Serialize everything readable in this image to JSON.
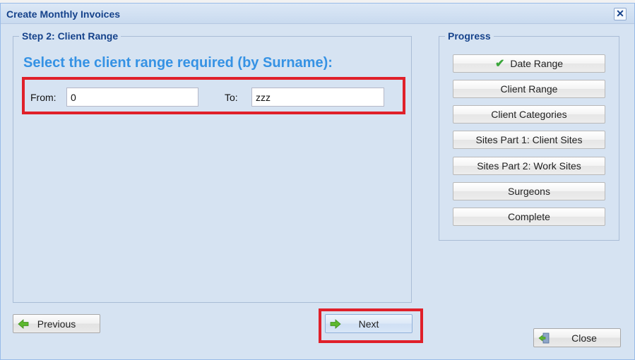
{
  "window": {
    "title": "Create Monthly Invoices",
    "close_glyph": "✕"
  },
  "step": {
    "legend": "Step 2: Client Range",
    "heading": "Select the client range required (by Surname):",
    "from_label": "From:",
    "from_value": "0",
    "to_label": "To:",
    "to_value": "zzz"
  },
  "progress": {
    "legend": "Progress",
    "items": [
      {
        "label": "Date Range",
        "completed": true,
        "icon": "checkmark-icon"
      },
      {
        "label": "Client Range"
      },
      {
        "label": "Client Categories"
      },
      {
        "label": "Sites Part 1: Client Sites"
      },
      {
        "label": "Sites Part 2: Work Sites"
      },
      {
        "label": "Surgeons"
      },
      {
        "label": "Complete"
      }
    ]
  },
  "buttons": {
    "previous": {
      "label": "Previous",
      "icon": "arrow-left-icon"
    },
    "next": {
      "label": "Next",
      "icon": "arrow-right-icon"
    },
    "close": {
      "label": "Close",
      "icon": "exit-door-icon"
    }
  },
  "colors": {
    "highlight": "#e0202a",
    "heading": "#3592e4",
    "title": "#15428b",
    "dialog_bg": "#d6e3f2",
    "check": "#3aa63a",
    "arrow": "#5cb82e"
  }
}
